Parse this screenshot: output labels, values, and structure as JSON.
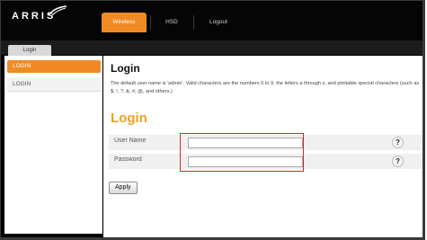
{
  "header": {
    "brand": "ARRIS",
    "nav": [
      {
        "label": "Wireless",
        "active": true
      },
      {
        "label": "HSD",
        "active": false
      },
      {
        "label": "Logout",
        "active": false
      }
    ],
    "accent_color": "#f08a24"
  },
  "subnav": {
    "tab": "Login"
  },
  "sidebar": {
    "items": [
      {
        "label": "LOGIN",
        "active": true
      },
      {
        "label": "LOGIN",
        "active": false
      }
    ]
  },
  "main": {
    "title": "Login",
    "description": "The default user name is 'admin'. Valid characters are the numbers 0 to 9, the letters a through z, and printable special characters (such as $, !, ?, &, #, @, and others.)",
    "section_title": "Login",
    "fields": [
      {
        "label": "User Name",
        "value": "",
        "placeholder": ""
      },
      {
        "label": "Password",
        "value": "",
        "placeholder": ""
      }
    ],
    "help_glyph": "?",
    "apply_label": "Apply",
    "highlight_color": "#d12a2a"
  }
}
